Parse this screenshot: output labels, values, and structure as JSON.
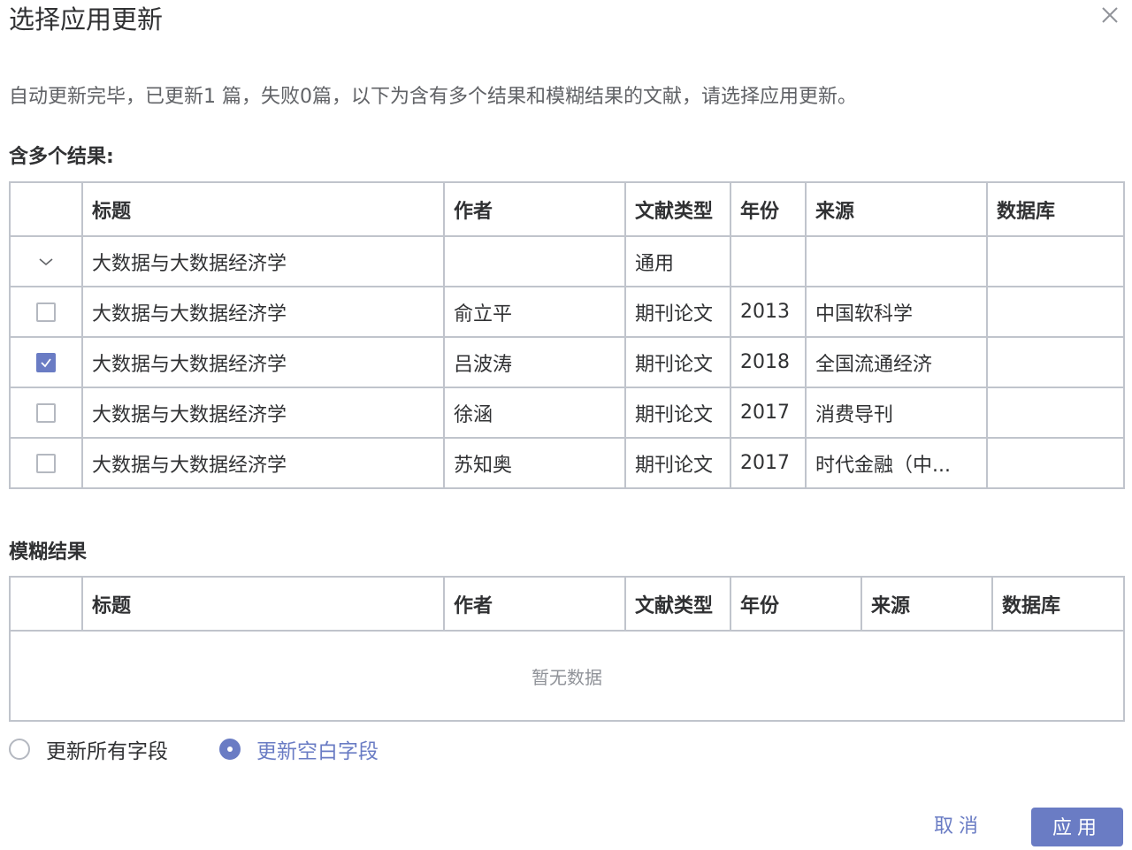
{
  "dialog": {
    "title": "选择应用更新",
    "intro": "自动更新完毕，已更新1 篇，失败0篇，以下为含有多个结果和模糊结果的文献，请选择应用更新。"
  },
  "multi": {
    "label": "含多个结果:",
    "headers": [
      "标题",
      "作者",
      "文献类型",
      "年份",
      "来源",
      "数据库"
    ],
    "group_row": {
      "title": "大数据与大数据经济学",
      "author": "",
      "type": "通用",
      "year": "",
      "source": "",
      "db": ""
    },
    "rows": [
      {
        "checked": false,
        "title": "大数据与大数据经济学",
        "author": "俞立平",
        "type": "期刊论文",
        "year": "2013",
        "source": "中国软科学",
        "db": ""
      },
      {
        "checked": true,
        "title": "大数据与大数据经济学",
        "author": "吕波涛",
        "type": "期刊论文",
        "year": "2018",
        "source": "全国流通经济",
        "db": ""
      },
      {
        "checked": false,
        "title": "大数据与大数据经济学",
        "author": "徐涵",
        "type": "期刊论文",
        "year": "2017",
        "source": "消费导刊",
        "db": ""
      },
      {
        "checked": false,
        "title": "大数据与大数据经济学",
        "author": "苏知奥",
        "type": "期刊论文",
        "year": "2017",
        "source": "时代金融（中...",
        "db": ""
      }
    ]
  },
  "fuzzy": {
    "label": "模糊结果",
    "headers": [
      "标题",
      "作者",
      "文献类型",
      "年份",
      "来源",
      "数据库"
    ],
    "empty_text": "暂无数据"
  },
  "options": {
    "update_all": "更新所有字段",
    "update_blank": "更新空白字段",
    "selected": "update_blank"
  },
  "footer": {
    "cancel": "取消",
    "apply": "应用"
  },
  "colors": {
    "accent": "#6a7cc4",
    "border": "#c0c4cc",
    "text": "#303133",
    "muted": "#909399"
  },
  "icons": {
    "close": "close-icon",
    "expand": "chevron-down-icon",
    "check": "check-icon"
  }
}
